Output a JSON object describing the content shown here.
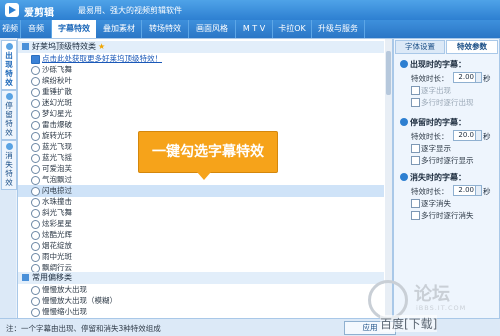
{
  "app": {
    "name": "爱剪辑",
    "slogan": "最易用、强大的视频剪辑软件"
  },
  "menu": [
    "视频",
    "音频",
    "字幕特效",
    "叠加素材",
    "转场特效",
    "画面风格",
    "M T V",
    "卡拉OK",
    "升级与服务"
  ],
  "menu_active": "字幕特效",
  "left_tabs": [
    {
      "label": "出现特效",
      "active": true
    },
    {
      "label": "停留特效",
      "active": false
    },
    {
      "label": "消失特效",
      "active": false
    }
  ],
  "list": {
    "section1_title": "好莱坞顶级特效类",
    "section1_items": [
      {
        "label": "点击此处获取更多好莱坞顶级特效！",
        "link": true
      },
      {
        "label": "沙砾飞舞"
      },
      {
        "label": "缤纷秋叶"
      },
      {
        "label": "重锤扩散"
      },
      {
        "label": "迷幻光斑"
      },
      {
        "label": "梦幻星光"
      },
      {
        "label": "雷击爆破"
      },
      {
        "label": "旋转光环"
      },
      {
        "label": "蓝光飞现"
      },
      {
        "label": "蓝光飞摇"
      },
      {
        "label": "可爱泡芙"
      },
      {
        "label": "气泡飘过"
      },
      {
        "label": "闪电掠过",
        "selected": true
      },
      {
        "label": "水珠撞击"
      },
      {
        "label": "斜光飞舞"
      },
      {
        "label": "炫彩星星"
      },
      {
        "label": "炫酷光辉"
      },
      {
        "label": "烟花绽放"
      },
      {
        "label": "雨中光斑"
      },
      {
        "label": "飘绸行云"
      }
    ],
    "section2_title": "常用偏移类",
    "section2_items": [
      {
        "label": "慢慢放大出现"
      },
      {
        "label": "慢慢放大出现（模糊）"
      },
      {
        "label": "慢慢缩小出现"
      }
    ]
  },
  "tooltip": "一键勾选字幕特效",
  "right_panel": {
    "tabs": [
      "字体设置",
      "特效参数"
    ],
    "appear": {
      "title": "出现时的字幕：",
      "duration_label": "特效时长：",
      "duration_value": "2.00",
      "unit": "秒",
      "check1": "逐字出现",
      "check2": "多行时逐行出现"
    },
    "stay": {
      "title": "停留时的字幕：",
      "duration_label": "特效时长：",
      "duration_value": "20.0",
      "unit": "秒",
      "check1": "逐字显示",
      "check2": "多行时逐行显示"
    },
    "disappear": {
      "title": "消失时的字幕：",
      "duration_label": "特效时长：",
      "duration_value": "2.00",
      "unit": "秒",
      "check1": "逐字消失",
      "check2": "多行时逐行消失"
    }
  },
  "status": {
    "text": "注：一个字幕由出现、停留和消失3种特效组成",
    "apply_button": "应用"
  },
  "watermark": {
    "title": "论坛",
    "site": "iBBS.IT.COM",
    "bottom": "百度[下载]"
  }
}
